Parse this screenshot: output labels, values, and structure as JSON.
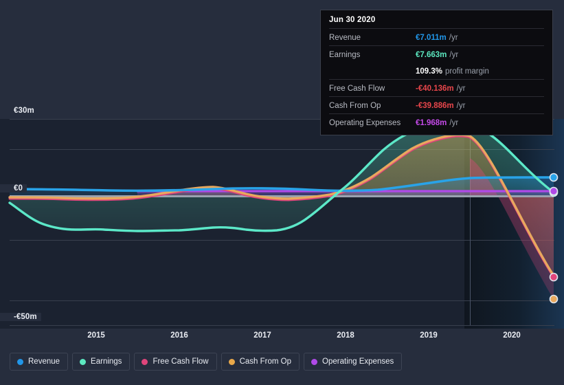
{
  "tooltip": {
    "date": "Jun 30 2020",
    "rows": [
      {
        "key": "Revenue",
        "value": "€7.011m",
        "unit": "/yr",
        "color": "#2196e8"
      },
      {
        "key": "Earnings",
        "value": "€7.663m",
        "unit": "/yr",
        "color": "#5ce8c0"
      },
      {
        "key": "",
        "value": "109.3%",
        "unit": "profit margin",
        "color": "#ffffff",
        "sub": true
      },
      {
        "key": "Free Cash Flow",
        "value": "-€40.136m",
        "unit": "/yr",
        "color": "#e8464b"
      },
      {
        "key": "Cash From Op",
        "value": "-€39.886m",
        "unit": "/yr",
        "color": "#e8464b"
      },
      {
        "key": "Operating Expenses",
        "value": "€1.968m",
        "unit": "/yr",
        "color": "#c44ae8"
      }
    ]
  },
  "legend": {
    "items": [
      {
        "label": "Revenue",
        "color": "#2196e8"
      },
      {
        "label": "Earnings",
        "color": "#5ce8c0"
      },
      {
        "label": "Free Cash Flow",
        "color": "#e0457b"
      },
      {
        "label": "Cash From Op",
        "color": "#e8a84a"
      },
      {
        "label": "Operating Expenses",
        "color": "#b04ae8"
      }
    ]
  },
  "axes": {
    "y_top_label": "€30m",
    "y_zero_label": "€0",
    "y_bottom_label": "-€50m",
    "x_labels": [
      "2015",
      "2016",
      "2017",
      "2018",
      "2019",
      "2020"
    ]
  },
  "chart_data": {
    "type": "area",
    "title": "",
    "xlabel": "",
    "ylabel": "",
    "currency": "EUR",
    "units": "millions",
    "ylim": [
      -50,
      30
    ],
    "xlim": [
      2014.47,
      2020.74
    ],
    "grid": true,
    "gridlines_y": [
      30,
      20,
      10,
      0,
      -10,
      -20,
      -30,
      -40,
      -50
    ],
    "legend_position": "bottom-left",
    "x_tick_values": [
      2015,
      2016,
      2017,
      2018,
      2019,
      2020
    ],
    "forecast_start": 2020.5,
    "highlight_point_x": 2020.5,
    "highlight_point_label": "Jun 30 2020",
    "x": [
      2014.47,
      2014.75,
      2015.0,
      2015.25,
      2015.5,
      2015.75,
      2016.0,
      2016.25,
      2016.5,
      2016.75,
      2017.0,
      2017.25,
      2017.5,
      2017.75,
      2018.0,
      2018.25,
      2018.5,
      2018.75,
      2019.0,
      2019.25,
      2019.5,
      2019.75,
      2020.0,
      2020.25,
      2020.5,
      2020.74
    ],
    "series": [
      {
        "name": "Revenue",
        "color": "#2196e8",
        "values": [
          4.9,
          4.9,
          4.8,
          4.7,
          4.6,
          4.5,
          4.5,
          4.6,
          4.7,
          4.8,
          4.9,
          5.0,
          4.9,
          4.7,
          4.5,
          4.4,
          4.4,
          4.5,
          4.7,
          5.1,
          5.6,
          6.2,
          6.7,
          6.9,
          7.011,
          7.05
        ],
        "end_value": 7.011
      },
      {
        "name": "Earnings",
        "color": "#5ce8c0",
        "values": [
          -0.2,
          -1.1,
          -2.2,
          -3.2,
          -3.7,
          -3.9,
          -4.0,
          -4.1,
          -4.1,
          -3.9,
          -3.6,
          -3.5,
          -3.6,
          -3.8,
          -3.6,
          -2.0,
          0.6,
          3.8,
          8.6,
          14.6,
          21.0,
          26.0,
          28.0,
          22.0,
          12.5,
          7.663
        ],
        "end_value": 7.663
      },
      {
        "name": "Free Cash Flow",
        "color": "#e0457b",
        "values": [
          -0.6,
          -0.6,
          -0.6,
          -0.6,
          -0.7,
          -0.7,
          -0.7,
          -0.6,
          -0.5,
          -0.3,
          0.3,
          1.1,
          0.4,
          -0.7,
          -1.1,
          -1.0,
          -0.8,
          -0.4,
          1.4,
          5.5,
          11.5,
          17.5,
          20.4,
          12.0,
          -14.0,
          -40.136
        ],
        "end_value": -40.136
      },
      {
        "name": "Cash From Op",
        "color": "#e8a84a",
        "values": [
          -0.4,
          -0.4,
          -0.4,
          -0.4,
          -0.5,
          -0.5,
          -0.5,
          -0.4,
          -0.3,
          -0.1,
          0.5,
          1.3,
          0.6,
          -0.5,
          -0.9,
          -0.8,
          -0.6,
          -0.2,
          1.6,
          5.7,
          11.7,
          17.7,
          20.6,
          12.2,
          -13.8,
          -39.886
        ],
        "end_value": -39.886
      },
      {
        "name": "Operating Expenses",
        "color": "#b04ae8",
        "values": [
          null,
          null,
          null,
          null,
          null,
          null,
          -1.6,
          -1.6,
          -1.6,
          -1.6,
          -1.6,
          -1.6,
          -1.6,
          -1.6,
          -1.6,
          -1.6,
          -1.6,
          -1.6,
          -1.6,
          -1.6,
          -1.6,
          -1.7,
          -1.8,
          -1.9,
          -1.968,
          -2.0
        ],
        "end_value": 1.968
      }
    ]
  }
}
